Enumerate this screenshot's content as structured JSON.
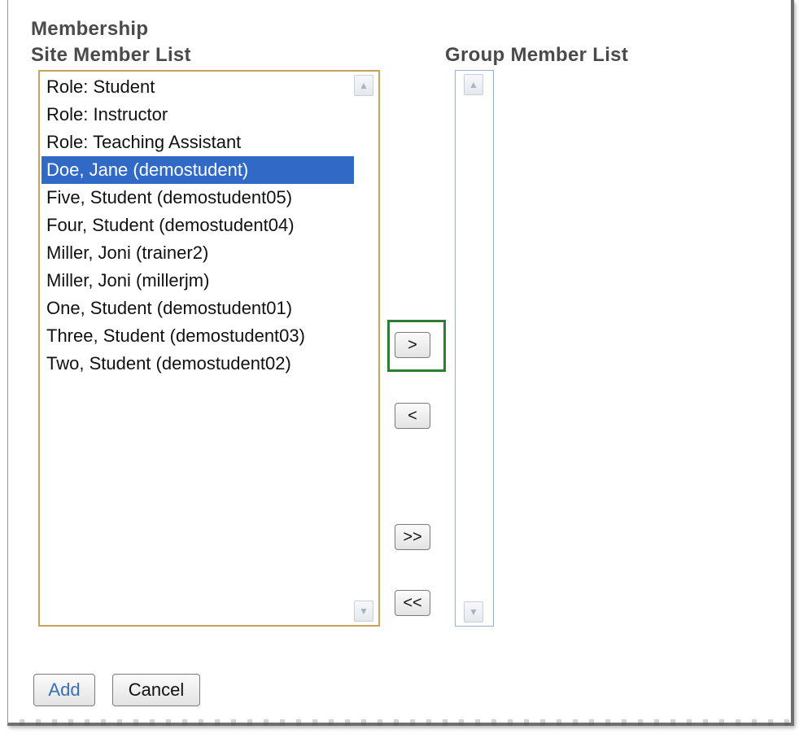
{
  "headings": {
    "membership": "Membership",
    "site_list": "Site Member List",
    "group_list": "Group Member List"
  },
  "site_members": [
    "Role: Student",
    "Role: Instructor",
    "Role: Teaching Assistant",
    "Doe, Jane (demostudent)",
    "Five, Student (demostudent05)",
    "Four, Student (demostudent04)",
    "Miller, Joni (trainer2)",
    "Miller, Joni (millerjm)",
    "One, Student (demostudent01)",
    "Three, Student (demostudent03)",
    "Two, Student (demostudent02)"
  ],
  "selected_index": 3,
  "group_members": [],
  "move_buttons": {
    "add_selected": ">",
    "remove_selected": "<",
    "add_all": ">>",
    "remove_all": "<<"
  },
  "actions": {
    "add": "Add",
    "cancel": "Cancel"
  },
  "colors": {
    "selection": "#3169c6",
    "site_list_border": "#c8a35d",
    "highlight": "#2e7d32",
    "add_text": "#3a6fb0"
  },
  "icons": {
    "scroll_up": "up-arrow",
    "scroll_down": "down-arrow"
  }
}
